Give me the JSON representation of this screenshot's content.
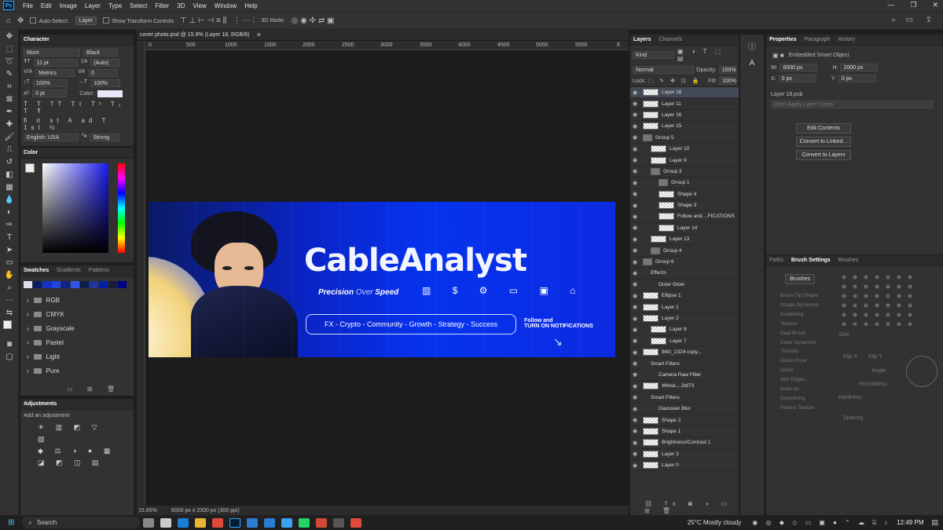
{
  "app": {
    "logo": "Ps",
    "menu": [
      "File",
      "Edit",
      "Image",
      "Layer",
      "Type",
      "Select",
      "Filter",
      "3D",
      "View",
      "Window",
      "Help"
    ]
  },
  "options_bar": {
    "auto_select_label": "Auto-Select:",
    "auto_select_value": "Layer",
    "transform_label": "Show Transform Controls",
    "mode_3d": "3D Mode:"
  },
  "document": {
    "tab_title": "cover photo.psd @ 15.9% (Layer 18, RGB/8)",
    "zoom": "15.85%",
    "info": "6000 px x 2000 px (300 ppi)",
    "ruler_marks": [
      "0",
      "500",
      "1000",
      "1500",
      "2000",
      "2500",
      "3000",
      "3500",
      "4000",
      "4500",
      "5000",
      "5500",
      "6"
    ]
  },
  "banner": {
    "title": "CableAnalyst",
    "tagline_a": "Precision",
    "tagline_b": "Over",
    "tagline_c": "Speed",
    "topics": "FX - Crypto - Community - Growth - Strategy - Success",
    "cta_line1": "Follow and",
    "cta_line2": "TURN ON NOTIFICATIONS"
  },
  "character": {
    "title": "Character",
    "font": "Mont",
    "style": "Black",
    "size": "11 pt",
    "leading": "(Auto)",
    "kerning": "Metrics",
    "tracking": "0",
    "vscale": "100%",
    "hscale": "100%",
    "baseline": "0 pt",
    "color_label": "Color:",
    "language": "English: USA",
    "aa": "Strong"
  },
  "color": {
    "title": "Color"
  },
  "swatches": {
    "tabs": [
      "Swatches",
      "Gradients",
      "Patterns"
    ],
    "groups": [
      "RGB",
      "CMYK",
      "Grayscale",
      "Pastel",
      "Light",
      "Pure"
    ]
  },
  "adjustments": {
    "title": "Adjustments",
    "hint": "Add an adjustment"
  },
  "layers_panel": {
    "tabs": [
      "Layers",
      "Channels"
    ],
    "filter": "Kind",
    "blend": "Normal",
    "opacity_label": "Opacity:",
    "opacity": "100%",
    "lock_label": "Lock:",
    "fill_label": "Fill:",
    "fill": "100%",
    "rows": [
      {
        "name": "Layer 18",
        "indent": 0
      },
      {
        "name": "Layer 11",
        "indent": 0
      },
      {
        "name": "Layer 16",
        "indent": 0
      },
      {
        "name": "Layer 15",
        "indent": 0
      },
      {
        "name": "Group 5",
        "indent": 0
      },
      {
        "name": "Layer 10",
        "indent": 1
      },
      {
        "name": "Layer 9",
        "indent": 1
      },
      {
        "name": "Group 3",
        "indent": 1
      },
      {
        "name": "Group 1",
        "indent": 2
      },
      {
        "name": "Shape 4",
        "indent": 2
      },
      {
        "name": "Shape 3",
        "indent": 2
      },
      {
        "name": "Follow and....FICATIONS",
        "indent": 2
      },
      {
        "name": "Layer 14",
        "indent": 2
      },
      {
        "name": "Layer 13",
        "indent": 1
      },
      {
        "name": "Group 4",
        "indent": 1
      },
      {
        "name": "Group 6",
        "indent": 0
      },
      {
        "name": "Effects",
        "indent": 1
      },
      {
        "name": "Outer Glow",
        "indent": 2
      },
      {
        "name": "Ellipse 1",
        "indent": 0
      },
      {
        "name": "Layer 1",
        "indent": 0
      },
      {
        "name": "Layer 2",
        "indent": 0
      },
      {
        "name": "Layer 8",
        "indent": 1
      },
      {
        "name": "Layer 7",
        "indent": 1
      },
      {
        "name": "IMG_2324 copy...",
        "indent": 0
      },
      {
        "name": "Smart Filters",
        "indent": 1
      },
      {
        "name": "Camera Raw Filter",
        "indent": 2
      },
      {
        "name": "Whisk....2bf73",
        "indent": 0
      },
      {
        "name": "Smart Filters",
        "indent": 1
      },
      {
        "name": "Gaussian Blur",
        "indent": 2
      },
      {
        "name": "Shape 2",
        "indent": 0
      },
      {
        "name": "Shape 1",
        "indent": 0
      },
      {
        "name": "Brightness/Contrast 1",
        "indent": 0
      },
      {
        "name": "Layer 3",
        "indent": 0
      },
      {
        "name": "Layer 0",
        "indent": 0
      }
    ]
  },
  "properties": {
    "tabs": [
      "Properties",
      "Paragraph",
      "History"
    ],
    "type": "Embedded Smart Object",
    "w_label": "W:",
    "w": "6000 px",
    "h_label": "H:",
    "h": "2000 px",
    "x_label": "X:",
    "x": "0 px",
    "y_label": "Y:",
    "y": "0 px",
    "file": "Layer 18.psb",
    "comp": "Don't Apply Layer Comp",
    "buttons": [
      "Edit Contents",
      "Convert to Linked...",
      "Convert to Layers"
    ]
  },
  "brush_settings": {
    "tabs": [
      "Paths",
      "Brush Settings",
      "Brushes"
    ],
    "brushes_btn": "Brushes",
    "options": [
      "Brush Tip Shape",
      "Shape Dynamics",
      "Scattering",
      "Texture",
      "Dual Brush",
      "Color Dynamics",
      "Transfer",
      "Brush Pose",
      "Noise",
      "Wet Edges",
      "Build-up",
      "Smoothing",
      "Protect Texture"
    ],
    "size": "Size",
    "flip_x": "Flip X",
    "flip_y": "Flip Y",
    "angle": "Angle:",
    "roundness": "Roundness:",
    "hardness": "Hardness",
    "spacing": "Spacing"
  },
  "taskbar": {
    "search": "Search",
    "weather": "25°C  Mostly cloudy",
    "time": "12:49 PM"
  },
  "colors": {
    "accent": "#31a8ff",
    "banner_blue": "#0633ef"
  }
}
